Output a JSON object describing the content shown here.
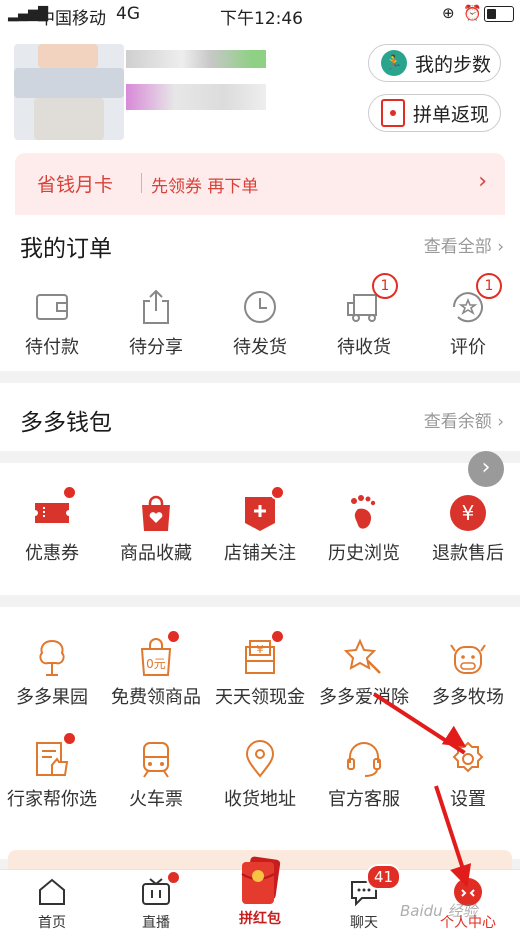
{
  "status_bar": {
    "carrier": "中国移动",
    "network": "4G",
    "time": "下午12:46"
  },
  "header_buttons": {
    "steps": "我的步数",
    "group_cashback": "拼单返现"
  },
  "banner": {
    "title": "省钱月卡",
    "subtitle": "先领券 再下单"
  },
  "orders": {
    "title": "我的订单",
    "view_all": "查看全部",
    "items": [
      {
        "label": "待付款",
        "icon": "wallet-icon"
      },
      {
        "label": "待分享",
        "icon": "share-icon"
      },
      {
        "label": "待发货",
        "icon": "clock-icon"
      },
      {
        "label": "待收货",
        "icon": "truck-icon",
        "badge": "1"
      },
      {
        "label": "评价",
        "icon": "review-icon",
        "badge": "1"
      }
    ]
  },
  "wallet": {
    "title": "多多钱包",
    "view_balance": "查看余额"
  },
  "shortcuts": [
    {
      "label": "优惠券",
      "icon": "coupon-icon"
    },
    {
      "label": "商品收藏",
      "icon": "favorite-bag-icon"
    },
    {
      "label": "店铺关注",
      "icon": "store-follow-icon"
    },
    {
      "label": "历史浏览",
      "icon": "footprint-icon"
    },
    {
      "label": "退款售后",
      "icon": "refund-icon"
    }
  ],
  "services_row1": [
    {
      "label": "多多果园",
      "icon": "tree-icon"
    },
    {
      "label": "免费领商品",
      "icon": "free-goods-icon",
      "goods_text": "0元"
    },
    {
      "label": "天天领现金",
      "icon": "cash-icon",
      "cash_text": "¥"
    },
    {
      "label": "多多爱消除",
      "icon": "star-wand-icon"
    },
    {
      "label": "多多牧场",
      "icon": "cow-icon"
    }
  ],
  "services_row2": [
    {
      "label": "行家帮你选",
      "icon": "expert-pick-icon"
    },
    {
      "label": "火车票",
      "icon": "train-icon"
    },
    {
      "label": "收货地址",
      "icon": "location-icon"
    },
    {
      "label": "官方客服",
      "icon": "headset-icon"
    },
    {
      "label": "设置",
      "icon": "gear-icon"
    }
  ],
  "tabbar": [
    {
      "label": "首页",
      "icon": "home-icon"
    },
    {
      "label": "直播",
      "icon": "tv-icon"
    },
    {
      "label": "拼红包",
      "icon": "red-envelope-icon"
    },
    {
      "label": "聊天",
      "icon": "chat-icon",
      "badge": "41"
    },
    {
      "label": "个人中心",
      "icon": "profile-icon"
    }
  ],
  "watermark": "Baidu 经验",
  "colors": {
    "brand_red": "#e02e24",
    "icon_orange": "#e0782d",
    "banner_bg": "#fdeceb"
  }
}
